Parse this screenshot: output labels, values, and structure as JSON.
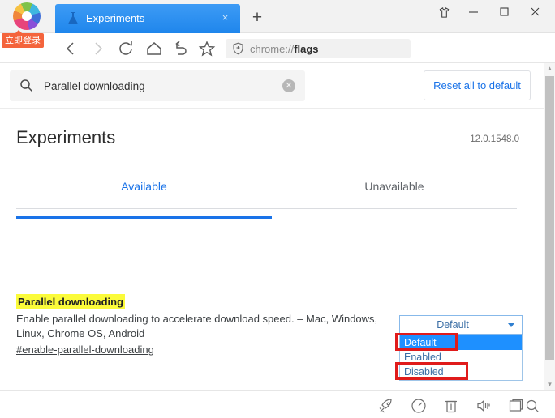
{
  "window": {
    "titlebar": {
      "brand_logo": "pinwheel-logo",
      "login_badge": "立即登录",
      "new_tab_label": "+",
      "tab": {
        "favicon": "flask-icon",
        "title": "Experiments",
        "close_label": "×"
      },
      "controls": [
        {
          "name": "theme-skin",
          "icon": "tshirt-icon"
        },
        {
          "name": "minimize",
          "icon": "minimize-icon"
        },
        {
          "name": "maximize",
          "icon": "maximize-icon"
        },
        {
          "name": "close",
          "icon": "close-icon"
        }
      ]
    },
    "navbar": {
      "buttons": [
        {
          "name": "back",
          "icon": "chevron-left-icon",
          "enabled": true
        },
        {
          "name": "forward",
          "icon": "chevron-right-icon",
          "enabled": false
        },
        {
          "name": "reload",
          "icon": "reload-icon",
          "enabled": true
        },
        {
          "name": "home",
          "icon": "home-icon",
          "enabled": true
        },
        {
          "name": "restore",
          "icon": "undo-arrow-icon",
          "enabled": true
        },
        {
          "name": "bookmark",
          "icon": "star-icon",
          "enabled": true
        }
      ],
      "address": {
        "shield_icon": "shield-plus-icon",
        "scheme": "chrome://",
        "path": "flags",
        "full": "chrome://flags"
      },
      "right_buttons": [
        {
          "name": "apps-grid",
          "icon": "four-squares-icon"
        },
        {
          "name": "overflow",
          "icon": "double-chevron-icon"
        },
        {
          "name": "screenshot",
          "icon": "scissors-icon"
        },
        {
          "name": "downloads",
          "icon": "download-arrow-icon"
        },
        {
          "name": "menu",
          "icon": "hamburger-icon"
        }
      ]
    }
  },
  "page": {
    "search": {
      "icon": "search-icon",
      "value": "Parallel downloading",
      "clear_label": "✕"
    },
    "reset_button": "Reset all to default",
    "title": "Experiments",
    "version": "12.0.1548.0",
    "tabs": [
      {
        "label": "Available",
        "active": true
      },
      {
        "label": "Unavailable",
        "active": false
      }
    ],
    "flag": {
      "title": "Parallel downloading",
      "description": "Enable parallel downloading to accelerate download speed. – Mac, Windows, Linux, Chrome OS, Android",
      "link": "#enable-parallel-downloading",
      "select": {
        "value": "Default",
        "options": [
          "Default",
          "Enabled",
          "Disabled"
        ],
        "open": true,
        "selected_index": 0
      },
      "highlight_color": "#fbfb3a",
      "annotation_color": "#e01b1b",
      "annotated_options": [
        "Default",
        "Disabled"
      ]
    }
  },
  "bottombar": {
    "buttons": [
      {
        "name": "boost",
        "icon": "rocket-icon"
      },
      {
        "name": "speed",
        "icon": "speedometer-icon"
      },
      {
        "name": "trash",
        "icon": "trash-icon"
      },
      {
        "name": "volume",
        "icon": "speaker-icon"
      },
      {
        "name": "window-split",
        "icon": "window-icon"
      },
      {
        "name": "find",
        "icon": "search-icon"
      }
    ]
  },
  "scrollbar": {
    "up_label": "▲",
    "down_label": "▼"
  }
}
